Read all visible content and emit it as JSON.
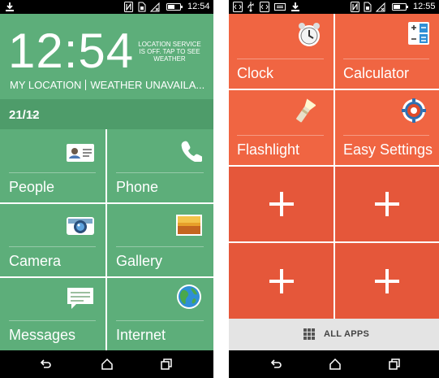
{
  "left_screen": {
    "status": {
      "time": "12:54"
    },
    "clock": {
      "time": "12:54",
      "location_notice": "LOCATION SERVICE IS OFF. TAP TO SEE WEATHER",
      "location": "MY LOCATION",
      "weather": "WEATHER UNAVAILA..."
    },
    "date": {
      "day_month": "21/12",
      "weather_condition": "--"
    },
    "tiles": [
      {
        "label": "People",
        "icon": "contact-card-icon"
      },
      {
        "label": "Phone",
        "icon": "phone-handset-icon"
      },
      {
        "label": "Camera",
        "icon": "camera-icon"
      },
      {
        "label": "Gallery",
        "icon": "gallery-picture-icon"
      },
      {
        "label": "Messages",
        "icon": "message-bubble-icon"
      },
      {
        "label": "Internet",
        "icon": "globe-icon"
      }
    ],
    "colors": {
      "tile": "#5dae7a",
      "date_strip": "#4e9c6a"
    }
  },
  "right_screen": {
    "status": {
      "time": "12:55"
    },
    "tiles": [
      {
        "label": "Clock",
        "icon": "alarm-clock-icon"
      },
      {
        "label": "Calculator",
        "icon": "calculator-icon"
      },
      {
        "label": "Flashlight",
        "icon": "flashlight-icon"
      },
      {
        "label": "Easy Settings",
        "icon": "settings-gear-icon"
      }
    ],
    "add_slots": 4,
    "all_apps": {
      "label": "ALL APPS",
      "icon": "app-grid-icon"
    },
    "colors": {
      "tile": "#f06542",
      "add_tile": "#e5573a",
      "bar": "#e4e4e4"
    }
  },
  "navigation": {
    "icons": [
      "back-icon",
      "home-icon",
      "recent-apps-icon"
    ]
  }
}
